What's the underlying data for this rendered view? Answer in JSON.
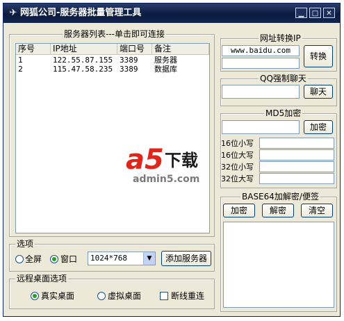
{
  "window": {
    "title": "网狐公司-服务器批量管理工具"
  },
  "server_list": {
    "group_title": "服务器列表---单击即可连接",
    "columns": [
      "序号",
      "IP地址",
      "端口号",
      "备注"
    ],
    "rows": [
      [
        "1",
        "122.55.87.155",
        "3389",
        "服务器"
      ],
      [
        "2",
        "115.47.58.235",
        "3389",
        "数据库"
      ]
    ]
  },
  "options": {
    "group_title": "选项",
    "fullscreen_label": "全屏",
    "window_label": "窗口",
    "mode_selected": "window",
    "resolution_value": "1024*768",
    "add_server_label": "添加服务器"
  },
  "remote_desktop": {
    "group_title": "远程桌面选项",
    "real_label": "真实桌面",
    "virtual_label": "虚拟桌面",
    "reconnect_label": "断线重连",
    "selected": "real",
    "reconnect_checked": false
  },
  "url_to_ip": {
    "title": "网址转换IP",
    "url_value": "www.baidu.com",
    "ip_value": "",
    "convert_label": "转换"
  },
  "qq_chat": {
    "title": "QQ强制聊天",
    "qq_value": "",
    "chat_label": "聊天"
  },
  "md5": {
    "title": "MD5加密",
    "input_value": "",
    "encrypt_label": "加密",
    "rows": [
      {
        "label": "16位小写",
        "value": ""
      },
      {
        "label": "16位大写",
        "value": ""
      },
      {
        "label": "32位小写",
        "value": ""
      },
      {
        "label": "32位大写",
        "value": ""
      }
    ]
  },
  "base64": {
    "title": "BASE64加解密/便签",
    "encrypt_label": "加密",
    "decrypt_label": "解密",
    "clear_label": "清空",
    "text_value": ""
  },
  "watermark": {
    "logo_text": "a5",
    "brand_text": "下载",
    "url_text": "admin5.com"
  }
}
